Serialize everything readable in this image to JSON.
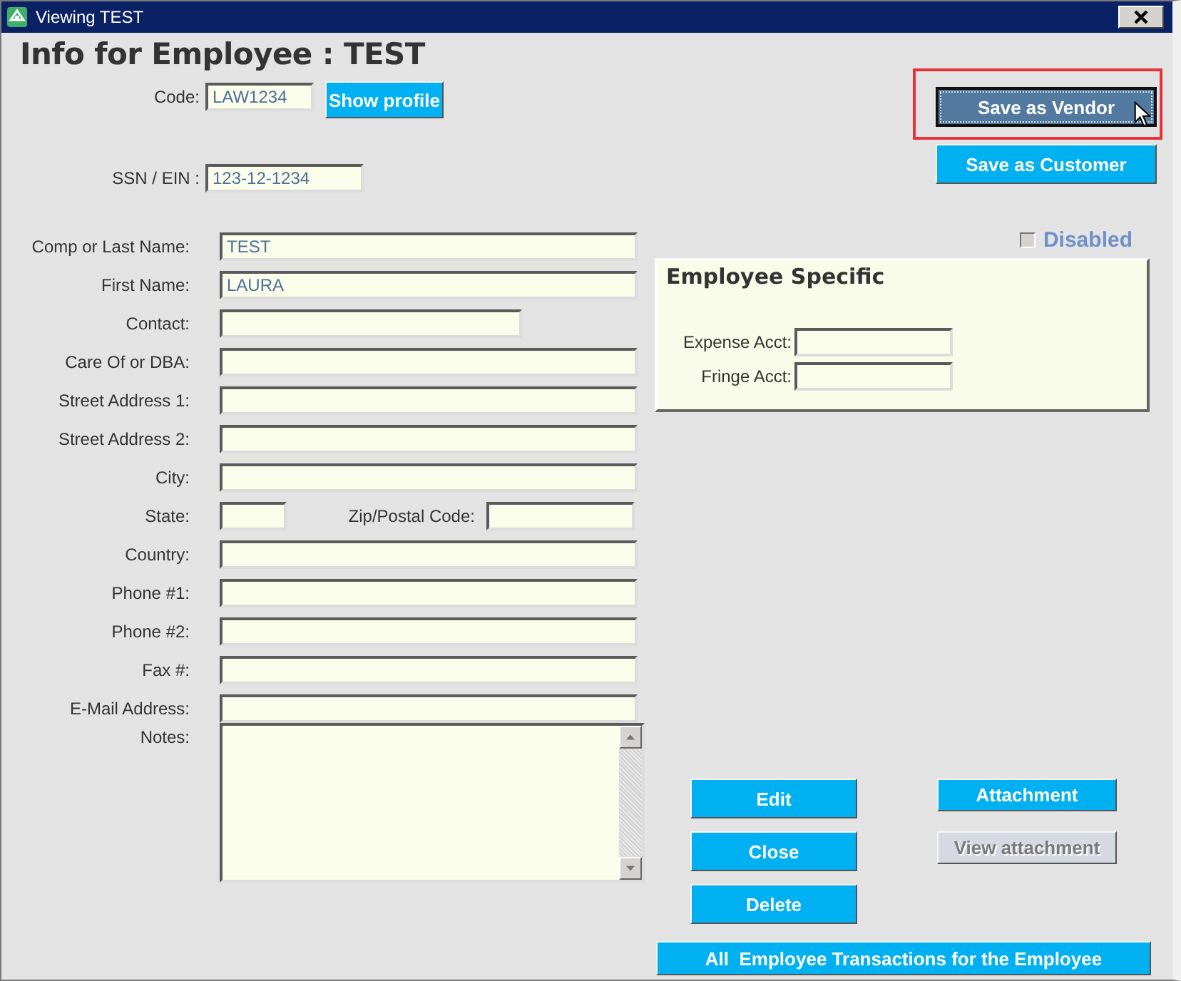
{
  "window": {
    "title": "Viewing TEST"
  },
  "heading": "Info for Employee : TEST",
  "code": {
    "label": "Code:",
    "value": "LAW1234"
  },
  "show_profile_button": "Show profile",
  "ssn": {
    "label": "SSN / EIN :",
    "value": "123-12-1234"
  },
  "save_buttons": [
    {
      "label": "Save as Vendor",
      "focused": true,
      "highlighted": true
    },
    {
      "label": "Save as Customer",
      "focused": false,
      "highlighted": false
    }
  ],
  "disabled_checkbox": {
    "label": "Disabled",
    "checked": false
  },
  "fields": [
    {
      "kind": "wide",
      "label": "Comp or Last Name:",
      "value": "TEST"
    },
    {
      "kind": "wide",
      "label": "First Name:",
      "value": "LAURA"
    },
    {
      "kind": "medium",
      "label": "Contact:"
    },
    {
      "kind": "wide",
      "label": "Care Of or DBA:"
    },
    {
      "kind": "wide",
      "label": "Street Address 1:"
    },
    {
      "kind": "wide",
      "label": "Street Address 2:"
    },
    {
      "kind": "wide",
      "label": "City:"
    },
    {
      "kind": "pair",
      "label": "State:",
      "second_label": "Zip/Postal Code:"
    },
    {
      "kind": "wide",
      "label": "Country:"
    },
    {
      "kind": "wide",
      "label": "Phone #1:"
    },
    {
      "kind": "wide",
      "label": "Phone #2:"
    },
    {
      "kind": "wide",
      "label": "Fax #:"
    },
    {
      "kind": "wide",
      "label": "E-Mail Address:"
    },
    {
      "kind": "notes",
      "label": "Notes:"
    }
  ],
  "employee_specific": {
    "title": "Employee Specific",
    "fields": [
      {
        "label": "Expense Acct:"
      },
      {
        "label": "Fringe Acct:"
      }
    ]
  },
  "record_buttons": [
    {
      "label": "Edit",
      "disabled": false
    },
    {
      "label": "Close",
      "disabled": false
    },
    {
      "label": "Delete",
      "disabled": false
    }
  ],
  "attachment_buttons": [
    {
      "label": "Attachment",
      "disabled": false
    },
    {
      "label": "View attachment",
      "disabled": true
    }
  ],
  "transactions_button": "All  Employee Transactions for the Employee"
}
